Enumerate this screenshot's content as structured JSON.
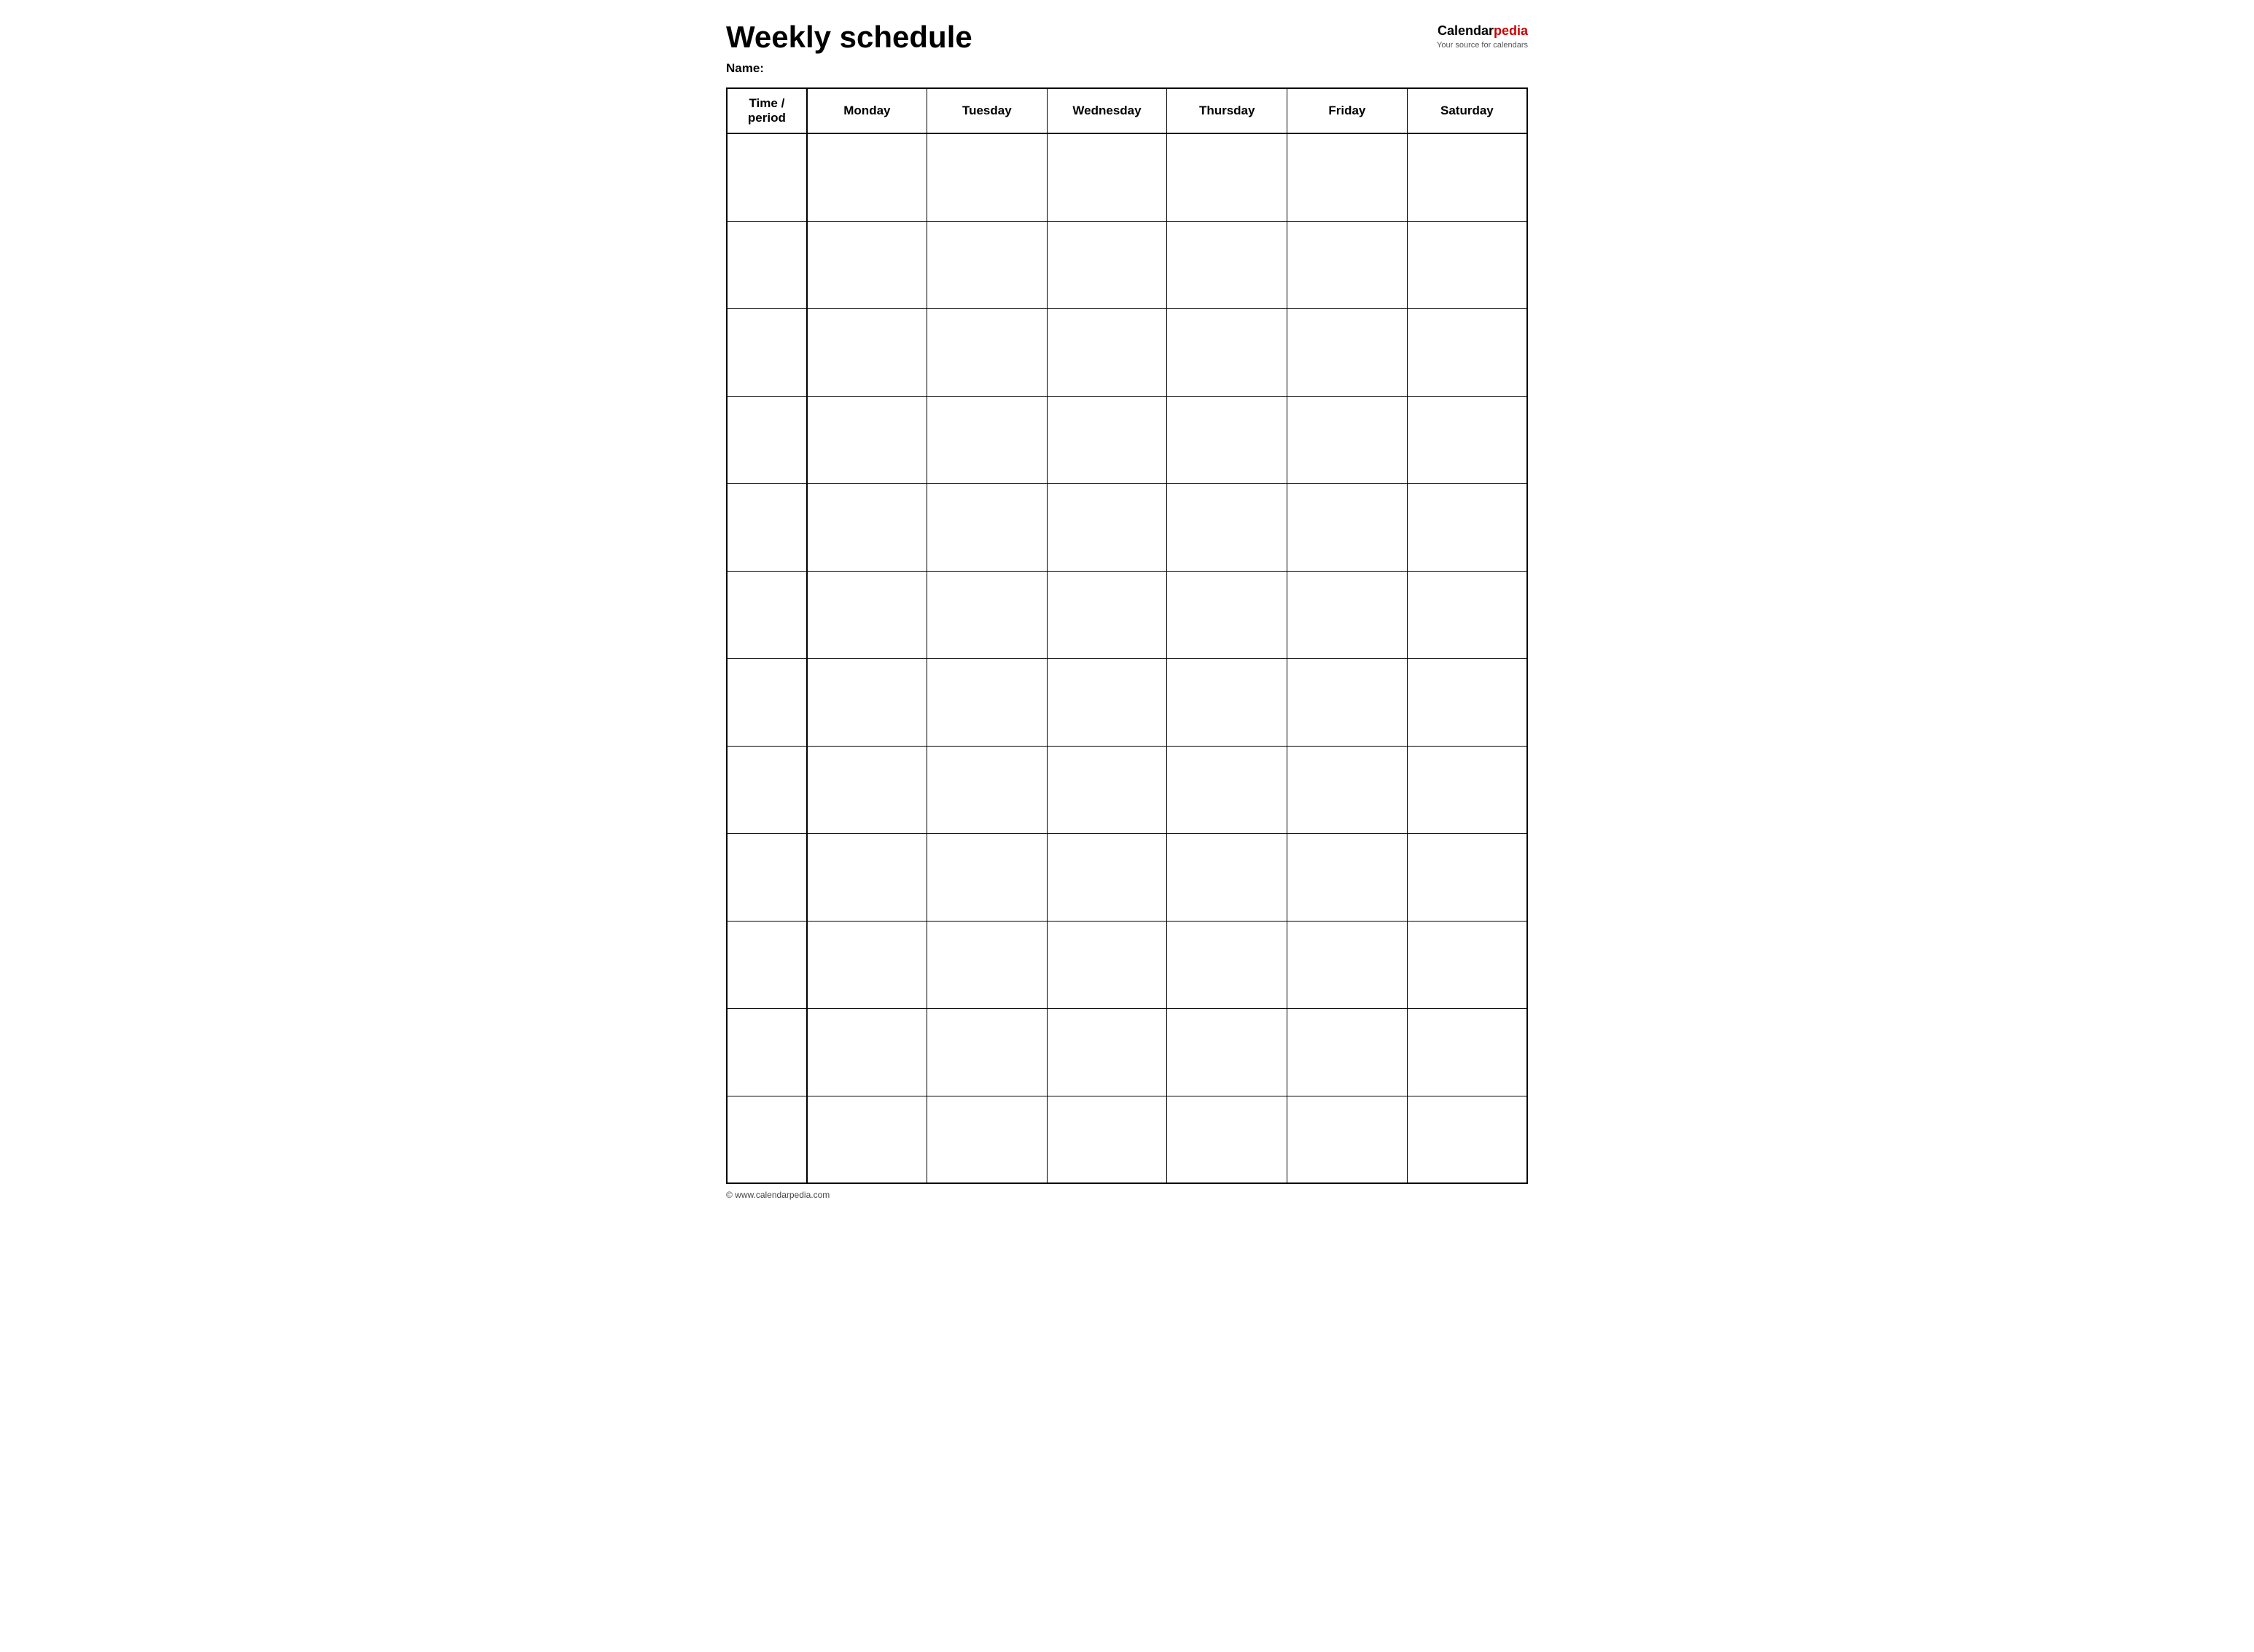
{
  "header": {
    "title": "Weekly schedule",
    "logo": {
      "calendar_text": "Calendar",
      "pedia_text": "pedia",
      "subtitle": "Your source for calendars"
    },
    "name_label": "Name:"
  },
  "table": {
    "columns": [
      {
        "id": "time",
        "label": "Time / period"
      },
      {
        "id": "monday",
        "label": "Monday"
      },
      {
        "id": "tuesday",
        "label": "Tuesday"
      },
      {
        "id": "wednesday",
        "label": "Wednesday"
      },
      {
        "id": "thursday",
        "label": "Thursday"
      },
      {
        "id": "friday",
        "label": "Friday"
      },
      {
        "id": "saturday",
        "label": "Saturday"
      }
    ],
    "row_count": 12
  },
  "footer": {
    "copyright": "© www.calendarpedia.com"
  }
}
